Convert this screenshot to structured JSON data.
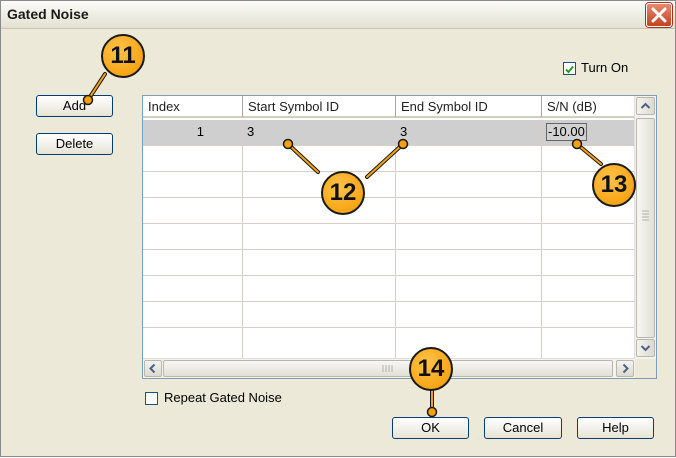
{
  "window": {
    "title": "Gated Noise",
    "close_icon": "close-icon"
  },
  "buttons": {
    "add": "Add",
    "delete": "Delete",
    "ok": "OK",
    "cancel": "Cancel",
    "help": "Help"
  },
  "turn_on": {
    "label": "Turn On",
    "checked": true
  },
  "repeat_gated_noise": {
    "label": "Repeat Gated Noise",
    "checked": false
  },
  "table": {
    "columns": [
      "Index",
      "Start Symbol ID",
      "End Symbol ID",
      "S/N (dB)"
    ],
    "rows": [
      {
        "index": "1",
        "start_symbol_id": "3",
        "end_symbol_id": "3",
        "sn_db": "-10.00",
        "selected": true
      }
    ]
  },
  "callouts": [
    "11",
    "12",
    "13",
    "14"
  ],
  "colors": {
    "callout_fill": "#f39a00",
    "selection": "#cfcfcf",
    "close_button": "#c3421e"
  }
}
